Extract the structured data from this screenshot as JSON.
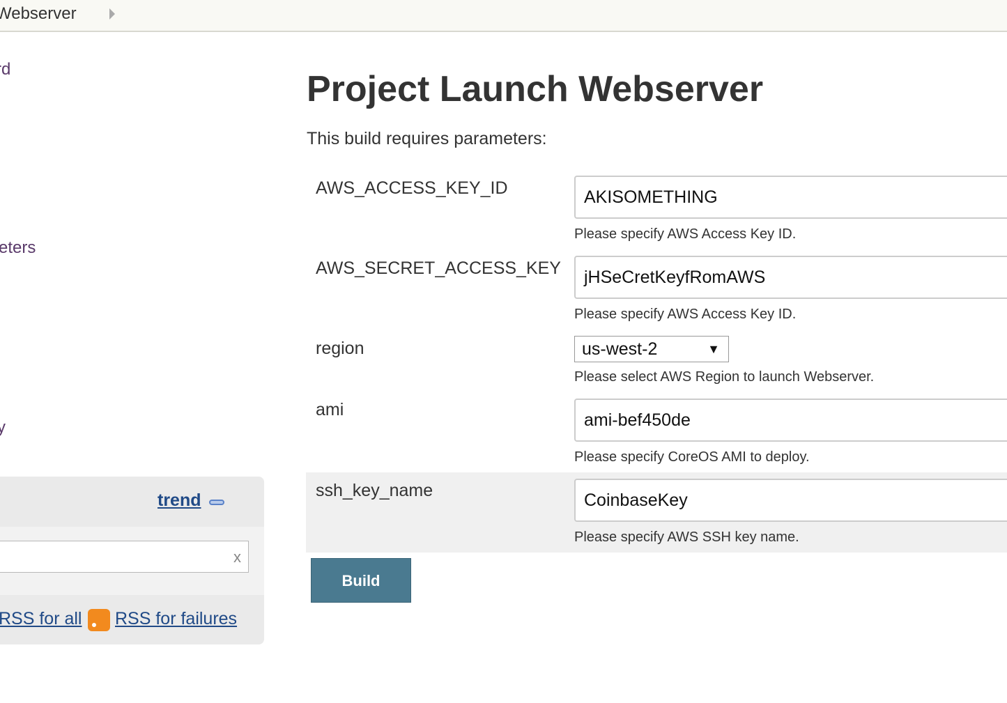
{
  "breadcrumb": {
    "item": "Webserver"
  },
  "sidenav": {
    "fragments": [
      "rd",
      "eters",
      "y"
    ]
  },
  "build_history": {
    "trend_label": "trend",
    "filter_value": "",
    "clear_label": "x",
    "rss_all": "RSS for all",
    "rss_failures": "RSS for failures"
  },
  "main": {
    "title": "Project Launch Webserver",
    "intro": "This build requires parameters:",
    "params": [
      {
        "name": "AWS_ACCESS_KEY_ID",
        "value": "AKISOMETHING",
        "description": "Please specify AWS Access Key ID."
      },
      {
        "name": "AWS_SECRET_ACCESS_KEY",
        "value": "jHSeCretKeyfRomAWS",
        "description": "Please specify AWS Access Key ID."
      },
      {
        "name": "region",
        "value": "us-west-2",
        "description": "Please select AWS Region to launch Webserver."
      },
      {
        "name": "ami",
        "value": "ami-bef450de",
        "description": "Please specify CoreOS AMI to deploy."
      },
      {
        "name": "ssh_key_name",
        "value": "CoinbaseKey",
        "description": "Please specify AWS SSH key name."
      }
    ],
    "build_label": "Build"
  },
  "colors": {
    "link": "#204a87",
    "nav_link": "#5a3a6a",
    "button": "#4a7a90",
    "rss": "#f28a1e"
  },
  "icons": [
    "breadcrumb-arrow-icon",
    "trend-icon",
    "rss-icon",
    "dropdown-caret-icon"
  ]
}
